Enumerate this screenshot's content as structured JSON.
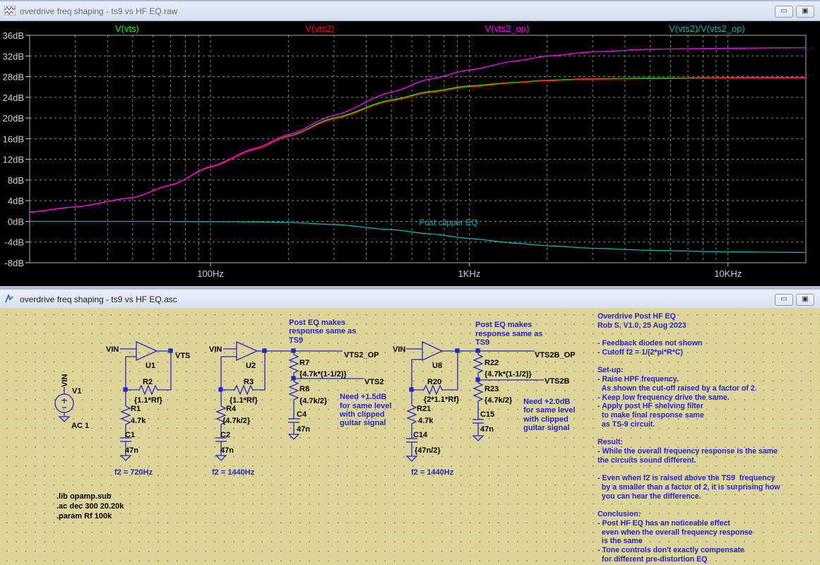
{
  "plot_window": {
    "title": "overdrive freq shaping - ts9 vs HF EQ.raw",
    "minimize": "▭",
    "maximize": "▣"
  },
  "schematic_window": {
    "title": "overdrive freq shaping - ts9 vs HF EQ.asc",
    "minimize": "▭",
    "maximize": "▣"
  },
  "chart_data": {
    "type": "line",
    "xscale": "log",
    "xlim": [
      20,
      20000
    ],
    "ylim": [
      -8,
      36
    ],
    "yticks": [
      "36dB",
      "32dB",
      "28dB",
      "24dB",
      "20dB",
      "16dB",
      "12dB",
      "8dB",
      "4dB",
      "0dB",
      "-4dB",
      "-8dB"
    ],
    "ytick_values": [
      36,
      32,
      28,
      24,
      20,
      16,
      12,
      8,
      4,
      0,
      -4,
      -8
    ],
    "xticks": [
      "100Hz",
      "1KHz",
      "10KHz"
    ],
    "xtick_values": [
      100,
      1000,
      10000
    ],
    "grid": true,
    "annotation": "Post clipper EQ",
    "series": [
      {
        "name": "V(vts)",
        "color": "#00ff00",
        "x": [
          20,
          30,
          50,
          70,
          100,
          150,
          200,
          300,
          500,
          700,
          1000,
          1500,
          2000,
          3000,
          5000,
          10000,
          20000
        ],
        "y": [
          1.8,
          2.8,
          4.6,
          7.0,
          10.5,
          14.0,
          16.5,
          20.0,
          23.5,
          25.1,
          26.2,
          26.9,
          27.3,
          27.6,
          27.7,
          27.8,
          27.8
        ]
      },
      {
        "name": "V(vts2)",
        "color": "#ff0000",
        "x": [
          20,
          30,
          50,
          70,
          100,
          150,
          200,
          300,
          500,
          700,
          1000,
          1500,
          2000,
          3000,
          5000,
          10000,
          20000
        ],
        "y": [
          1.8,
          2.8,
          4.6,
          7.0,
          10.5,
          14.0,
          16.4,
          19.8,
          23.3,
          24.9,
          26.0,
          26.8,
          27.2,
          27.5,
          27.6,
          27.7,
          27.7
        ]
      },
      {
        "name": "V(vts2_op)",
        "color": "#ff00ff",
        "x": [
          20,
          30,
          50,
          70,
          100,
          150,
          200,
          300,
          500,
          700,
          1000,
          1500,
          2000,
          3000,
          5000,
          10000,
          20000
        ],
        "y": [
          1.8,
          2.8,
          4.6,
          7.0,
          10.6,
          14.2,
          16.8,
          20.5,
          25.0,
          27.5,
          29.3,
          31.0,
          32.0,
          32.8,
          33.3,
          33.5,
          33.6
        ]
      },
      {
        "name": "V(vts2)/V(vts2_op)",
        "color": "#00b4b4",
        "x": [
          20,
          50,
          100,
          150,
          200,
          300,
          500,
          700,
          1000,
          1500,
          2000,
          3000,
          5000,
          10000,
          20000
        ],
        "y": [
          0,
          0,
          -0.05,
          -0.1,
          -0.2,
          -0.6,
          -1.6,
          -2.4,
          -3.3,
          -4.2,
          -4.7,
          -5.2,
          -5.6,
          -5.9,
          -6.0
        ]
      }
    ]
  },
  "schematic": {
    "v1": {
      "name": "V1",
      "node": "VIN",
      "value": "AC 1"
    },
    "c1": {
      "vin": "VIN",
      "opamp": "U1",
      "out": "VTS",
      "rf": "R2",
      "rf_val": "{1.1*Rf}",
      "rg": "R1",
      "rg_val": "4.7k",
      "cg": "C1",
      "cg_val": "47n",
      "f2": "f2 = 720Hz"
    },
    "c2": {
      "vin": "VIN",
      "opamp": "U2",
      "rf": "R3",
      "rf_val": "{1.1*Rf}",
      "rg": "R4",
      "rg_val": "{4.7k/2}",
      "cg": "C2",
      "cg_val": "47n",
      "f2": "f2 = 1440Hz",
      "out_op": "VTS2_OP",
      "out": "VTS2",
      "ra": "R7",
      "ra_val": "{4.7k*(1-1/2)}",
      "rb": "R8",
      "rb_val": "{4.7k/2}",
      "cc": "C4",
      "cc_val": "47n",
      "note": [
        "Post EQ makes",
        "response same as",
        "TS9"
      ],
      "need": [
        "Need +1.5dB",
        "for same level",
        "with clipped",
        "guitar signal"
      ]
    },
    "c3": {
      "vin": "VIN",
      "opamp": "U8",
      "rf": "R20",
      "rf_val": "{2*1.1*Rf}",
      "rg": "R21",
      "rg_val": "4.7k",
      "cg": "C14",
      "cg_val": "{47n/2}",
      "f2": "f2 = 1440Hz",
      "out_op": "VTS2B_OP",
      "out": "VTS2B",
      "ra": "R22",
      "ra_val": "{4.7k*(1-1/2)}",
      "rb": "R23",
      "rb_val": "{4.7k/2}",
      "cc": "C15",
      "cc_val": "47n",
      "note": [
        "Post EQ makes",
        "response same as",
        "TS9"
      ],
      "need": [
        "Need +2.0dB",
        "for same level",
        "with clipped",
        "guitar signal"
      ]
    },
    "directives": [
      ".lib opamp.sub",
      ".ac dec 300 20.20k",
      ".param Rf 100k"
    ],
    "notes": "Overdrive Post HF EQ\nRob S, V1.0, 25 Aug 2023\n\n- Feedback diodes not shown\n- Cutoff f2 = 1/(2*pi*R*C)\n\nSet-up:\n- Raise HPF frequency.\n  As shown the cut-off raised by a factor of 2.\n- Keep low frequency drive the same.\n- Apply post HF shelving filter\n  to make final response same\n  as TS-9 circuit.\n\nResult:\n- While the overall frequency response is the same\nthe circuits sound different.\n\n- Even when f2 is raised above the TS9  frequency\n  by a smaller than a factor of 2, it is surprising how\n  you can hear the difference.\n\nConclusion:\n- Post HF EQ has an noticeable effect\n  even when the overall frequency response\n  is the same\n- Tone controls don't exactly compensate\n  for different pre-distortion EQ"
  }
}
